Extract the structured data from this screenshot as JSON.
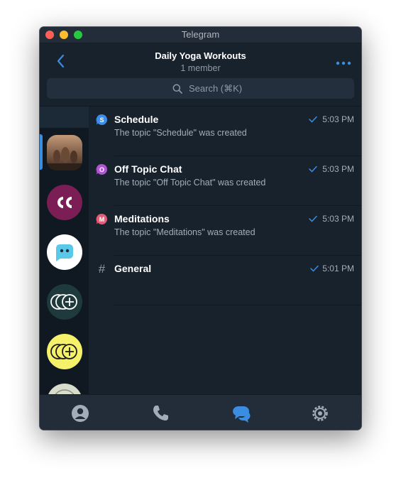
{
  "window": {
    "title": "Telegram"
  },
  "header": {
    "title": "Daily Yoga Workouts",
    "subtitle": "1 member"
  },
  "search": {
    "placeholder": "Search (⌘K)"
  },
  "rail": {
    "items": [
      {
        "name": "yoga-group-avatar",
        "icon": "yoga-photo"
      },
      {
        "name": "cc-chat-avatar",
        "icon": "cc-quote-icon",
        "color": "#7a1e55"
      },
      {
        "name": "ghost-bot-avatar",
        "icon": "ghost-icon",
        "color": "#ffffff"
      },
      {
        "name": "circles-channel-avatar",
        "icon": "overlapping-circles-plus-icon",
        "color": "#1f3a3c"
      },
      {
        "name": "circles-yellow-avatar",
        "icon": "overlapping-circles-plus-icon",
        "color": "#f5f16a"
      },
      {
        "name": "partial-avatar",
        "icon": "circle-icon",
        "color": "#d8dccd"
      }
    ]
  },
  "topics": [
    {
      "name": "Schedule",
      "message": "The topic \"Schedule\" was created",
      "time": "5:03 PM",
      "icon_letter": "S",
      "icon_color": "#3e8ee8"
    },
    {
      "name": "Off Topic Chat",
      "message": "The topic \"Off Topic Chat\" was created",
      "time": "5:03 PM",
      "icon_letter": "O",
      "icon_color": "#b155d6"
    },
    {
      "name": "Meditations",
      "message": "The topic \"Meditations\" was created",
      "time": "5:03 PM",
      "icon_letter": "M",
      "icon_color": "#e65c78"
    },
    {
      "name": "General",
      "message": "",
      "time": "5:01 PM",
      "icon_letter": "#",
      "icon_color": "#8e9aa7"
    }
  ],
  "tabs": [
    {
      "name": "contacts",
      "icon": "person-icon",
      "active": false
    },
    {
      "name": "calls",
      "icon": "phone-icon",
      "active": false
    },
    {
      "name": "chats",
      "icon": "chat-bubbles-icon",
      "active": true
    },
    {
      "name": "settings",
      "icon": "gear-icon",
      "active": false
    }
  ],
  "colors": {
    "accent": "#3a8de0",
    "background": "#18222d",
    "text_secondary": "#a3adb8"
  }
}
